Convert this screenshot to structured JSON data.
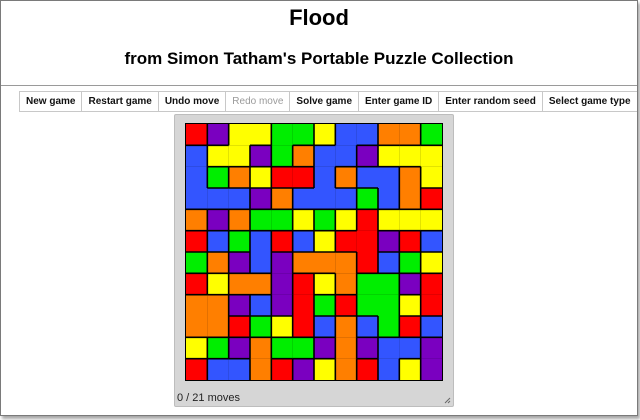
{
  "header": {
    "title": "Flood",
    "subtitle": "from Simon Tatham's Portable Puzzle Collection"
  },
  "menu": {
    "items": [
      {
        "label": "New game",
        "enabled": true
      },
      {
        "label": "Restart game",
        "enabled": true
      },
      {
        "label": "Undo move",
        "enabled": true
      },
      {
        "label": "Redo move",
        "enabled": false
      },
      {
        "label": "Solve game",
        "enabled": true
      },
      {
        "label": "Enter game ID",
        "enabled": true
      },
      {
        "label": "Enter random seed",
        "enabled": true
      },
      {
        "label": "Select game type",
        "enabled": true
      }
    ]
  },
  "puzzle": {
    "status": "0 / 21 moves",
    "colors": {
      "0": "#ff0000",
      "1": "#ffff00",
      "2": "#00ee00",
      "3": "#3355ff",
      "4": "#ff7f00",
      "5": "#7a00c0"
    },
    "grid": [
      [
        0,
        5,
        1,
        1,
        2,
        2,
        1,
        3,
        3,
        4,
        4,
        2
      ],
      [
        3,
        1,
        1,
        5,
        2,
        4,
        3,
        3,
        5,
        1,
        1,
        1
      ],
      [
        3,
        2,
        4,
        1,
        0,
        0,
        3,
        4,
        3,
        3,
        4,
        1
      ],
      [
        3,
        3,
        3,
        5,
        4,
        3,
        3,
        3,
        2,
        3,
        4,
        0
      ],
      [
        4,
        5,
        4,
        2,
        2,
        1,
        2,
        1,
        0,
        1,
        1,
        1
      ],
      [
        0,
        3,
        2,
        3,
        0,
        3,
        1,
        0,
        0,
        5,
        0,
        3
      ],
      [
        2,
        4,
        5,
        3,
        5,
        4,
        4,
        4,
        0,
        3,
        2,
        1
      ],
      [
        0,
        1,
        4,
        4,
        5,
        0,
        1,
        4,
        2,
        2,
        5,
        0
      ],
      [
        4,
        4,
        5,
        3,
        5,
        0,
        2,
        0,
        2,
        2,
        1,
        0
      ],
      [
        4,
        4,
        0,
        2,
        1,
        0,
        3,
        4,
        3,
        2,
        0,
        3
      ],
      [
        1,
        2,
        5,
        4,
        2,
        2,
        5,
        4,
        5,
        3,
        3,
        5
      ],
      [
        0,
        3,
        3,
        4,
        0,
        5,
        1,
        4,
        0,
        3,
        1,
        5
      ]
    ]
  }
}
